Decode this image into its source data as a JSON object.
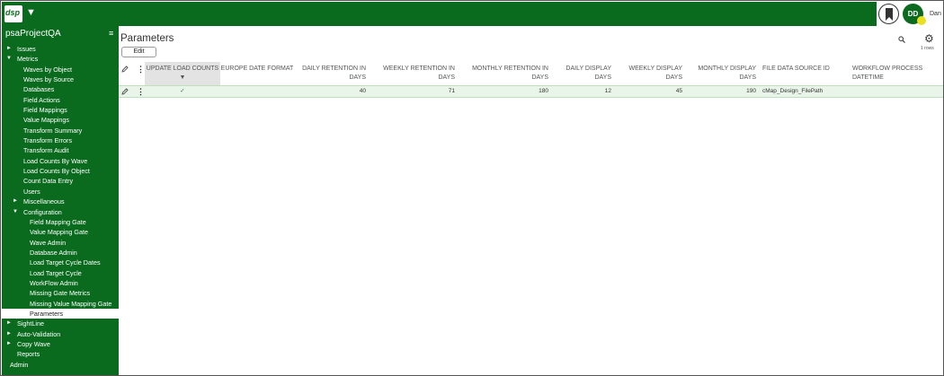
{
  "app": {
    "logo_text": "dsp",
    "logo_caret": "▼"
  },
  "user": {
    "initials": "DD",
    "name": "Dan"
  },
  "sidebar": {
    "project": "psaProjectQA",
    "items": [
      {
        "label": "Issues",
        "level": 0,
        "arrow": "►"
      },
      {
        "label": "Metrics",
        "level": 0,
        "arrow": "▼"
      },
      {
        "label": "Waves by Object",
        "level": 1
      },
      {
        "label": "Waves by Source",
        "level": 1
      },
      {
        "label": "Databases",
        "level": 1
      },
      {
        "label": "Field Actions",
        "level": 1
      },
      {
        "label": "Field Mappings",
        "level": 1
      },
      {
        "label": "Value Mappings",
        "level": 1
      },
      {
        "label": "Transform Summary",
        "level": 1
      },
      {
        "label": "Transform Errors",
        "level": 1
      },
      {
        "label": "Transform Audit",
        "level": 1
      },
      {
        "label": "Load Counts By Wave",
        "level": 1
      },
      {
        "label": "Load Counts By Object",
        "level": 1
      },
      {
        "label": "Count Data Entry",
        "level": 1
      },
      {
        "label": "Users",
        "level": 1
      },
      {
        "label": "Miscellaneous",
        "level": 1,
        "arrow": "►"
      },
      {
        "label": "Configuration",
        "level": 1,
        "arrow": "▼"
      },
      {
        "label": "Field Mapping Gate",
        "level": 2
      },
      {
        "label": "Value Mapping Gate",
        "level": 2
      },
      {
        "label": "Wave Admin",
        "level": 2
      },
      {
        "label": "Database Admin",
        "level": 2
      },
      {
        "label": "Load Target Cycle Dates",
        "level": 2
      },
      {
        "label": "Load Target Cycle",
        "level": 2
      },
      {
        "label": "WorkFlow Admin",
        "level": 2
      },
      {
        "label": "Missing Gate Metrics",
        "level": 2
      },
      {
        "label": "Missing Value Mapping Gate",
        "level": 2
      },
      {
        "label": "Parameters",
        "level": 2,
        "active": true
      },
      {
        "label": "SightLine",
        "level": 0,
        "arrow": "►"
      },
      {
        "label": "Auto-Validation",
        "level": 0,
        "arrow": "►"
      },
      {
        "label": "Copy Wave",
        "level": 0,
        "arrow": "►"
      },
      {
        "label": "Reports",
        "level": 0
      },
      {
        "label": "Admin",
        "level": -1
      }
    ]
  },
  "main": {
    "title": "Parameters",
    "edit_label": "Edit",
    "rows_count": "1 rows",
    "columns": [
      {
        "label": "UPDATE LOAD COUNTS ▼",
        "sorted": true
      },
      {
        "label": "EUROPE DATE FORMAT"
      },
      {
        "label": "DAILY RETENTION IN DAYS"
      },
      {
        "label": "WEEKLY RETENTION IN DAYS"
      },
      {
        "label": "MONTHLY RETENTION IN DAYS"
      },
      {
        "label": "DAILY DISPLAY DAYS"
      },
      {
        "label": "WEEKLY DISPLAY DAYS"
      },
      {
        "label": "MONTHLY DISPLAY DAYS"
      },
      {
        "label": "FILE DATA SOURCE ID"
      },
      {
        "label": "WORKFLOW PROCESS DATETIME"
      }
    ],
    "rows": [
      [
        "✓",
        "",
        "40",
        "71",
        "180",
        "12",
        "45",
        "190",
        "cMap_Design_FilePath",
        ""
      ]
    ]
  }
}
